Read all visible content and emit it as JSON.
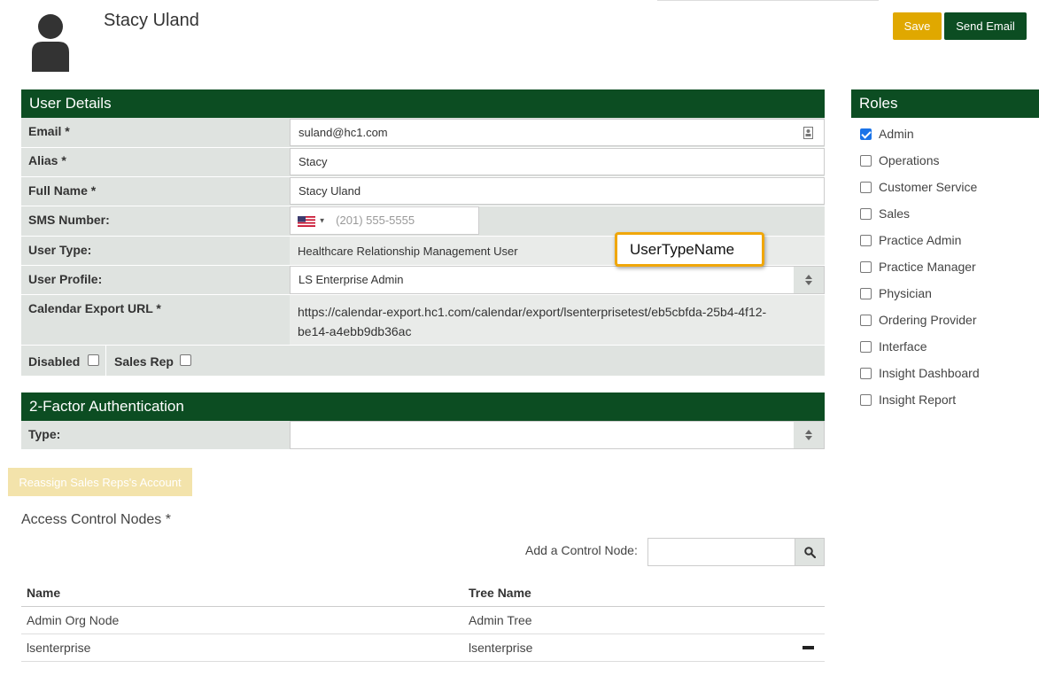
{
  "header": {
    "user_name": "Stacy Uland",
    "save_label": "Save",
    "send_email_label": "Send Email"
  },
  "user_details": {
    "title": "User Details",
    "email_label": "Email *",
    "email_value": "suland@hc1.com",
    "alias_label": "Alias *",
    "alias_value": "Stacy",
    "fullname_label": "Full Name *",
    "fullname_value": "Stacy Uland",
    "sms_label": "SMS Number:",
    "sms_placeholder": "(201) 555-5555",
    "usertype_label": "User Type:",
    "usertype_value": "Healthcare Relationship Management User",
    "userprofile_label": "User Profile:",
    "userprofile_value": "LS Enterprise Admin",
    "calendar_label": "Calendar Export URL *",
    "calendar_line1": "https://calendar-export.hc1.com/calendar/export/lsenterprisetest/eb5cbfda-25b4-4f12-",
    "calendar_line2": "be14-a4ebb9db36ac",
    "disabled_label": "Disabled",
    "salesrep_label": "Sales Rep"
  },
  "tooltip": {
    "text": "UserTypeName"
  },
  "two_factor": {
    "title": "2-Factor Authentication",
    "type_label": "Type:",
    "type_value": ""
  },
  "roles": {
    "title": "Roles",
    "items": [
      {
        "label": "Admin",
        "checked": true
      },
      {
        "label": "Operations",
        "checked": false
      },
      {
        "label": "Customer Service",
        "checked": false
      },
      {
        "label": "Sales",
        "checked": false
      },
      {
        "label": "Practice Admin",
        "checked": false
      },
      {
        "label": "Practice Manager",
        "checked": false
      },
      {
        "label": "Physician",
        "checked": false
      },
      {
        "label": "Ordering Provider",
        "checked": false
      },
      {
        "label": "Interface",
        "checked": false
      },
      {
        "label": "Insight Dashboard",
        "checked": false
      },
      {
        "label": "Insight Report",
        "checked": false
      }
    ]
  },
  "reassign_label": "Reassign Sales Reps's Account",
  "access_control": {
    "title": "Access Control Nodes *",
    "add_label": "Add a Control Node:",
    "columns": [
      "Name",
      "Tree Name"
    ],
    "rows": [
      {
        "name": "Admin Org Node",
        "tree": "Admin Tree"
      },
      {
        "name": "lsenterprise",
        "tree": "lsenterprise"
      }
    ]
  },
  "colors": {
    "brand_green": "#0c4d22",
    "save_yellow": "#e0a800",
    "row_gray": "#dfe3e0",
    "tooltip_border": "#f0a70a"
  }
}
